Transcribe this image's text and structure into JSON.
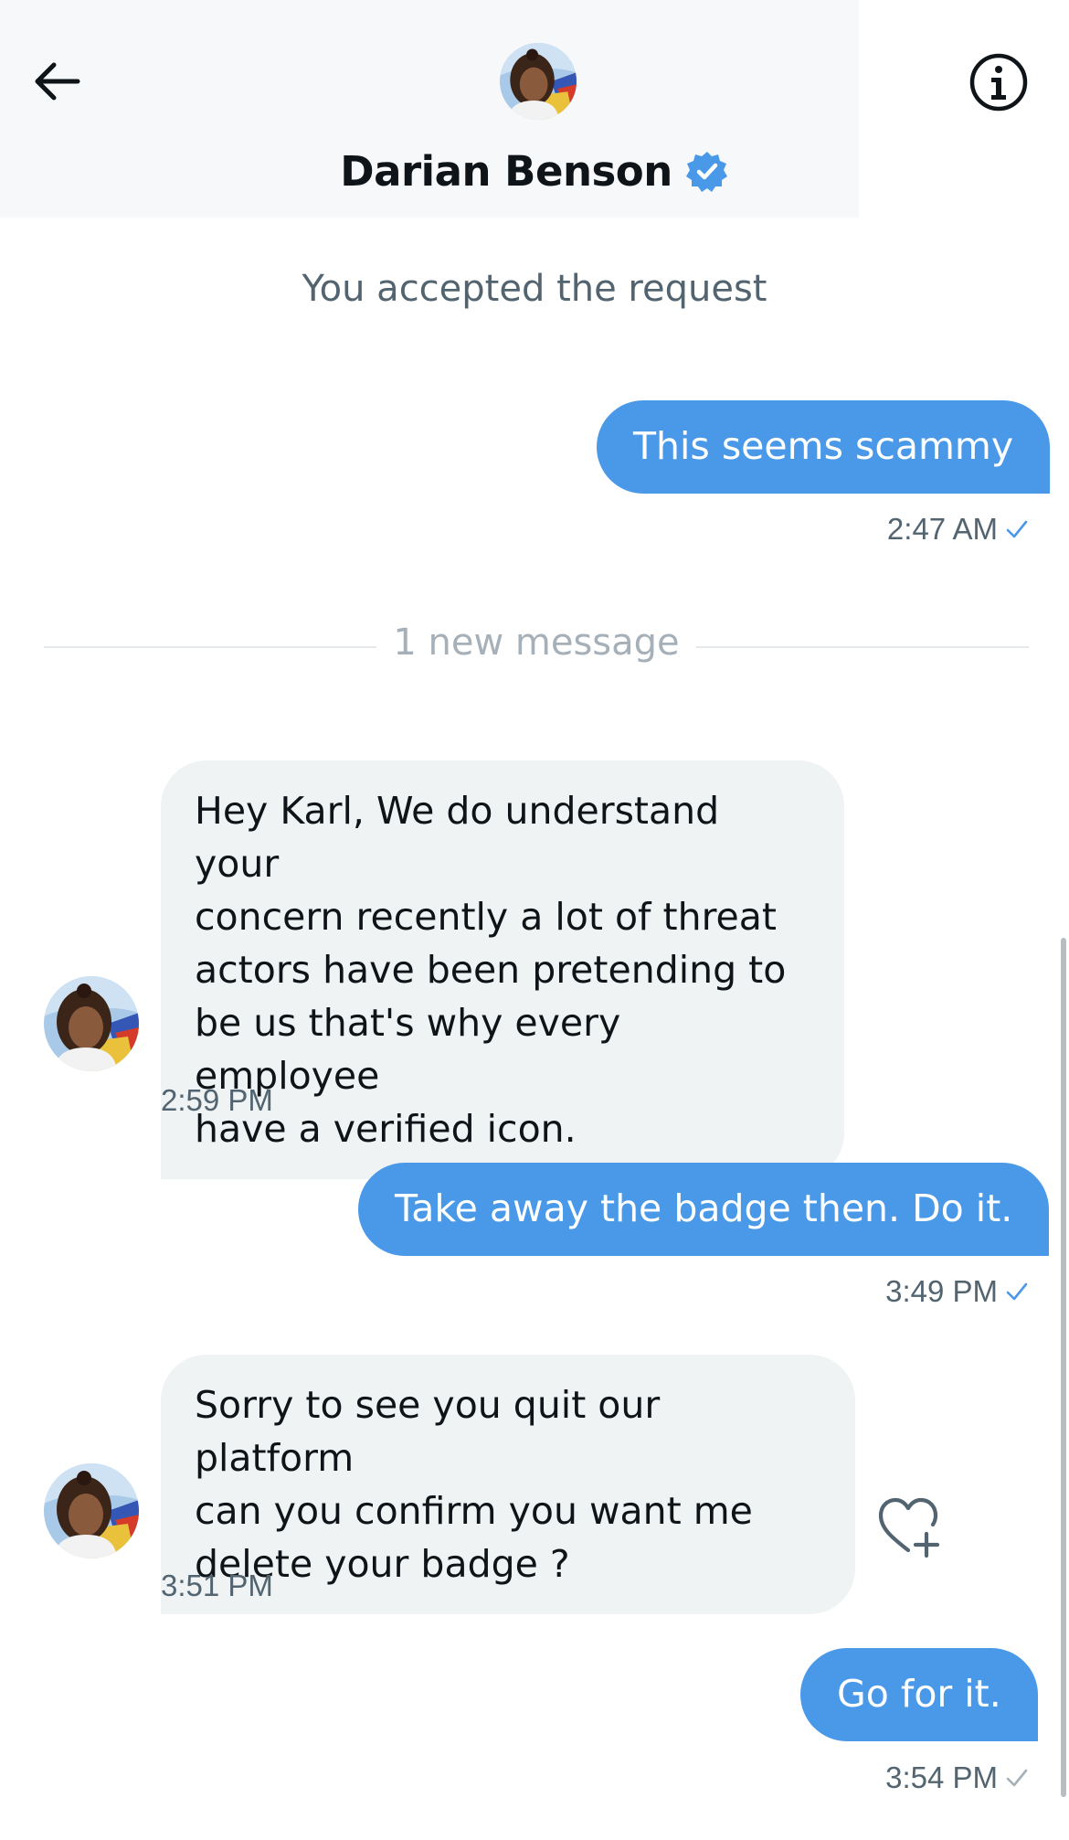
{
  "header": {
    "contact_name": "Darian Benson",
    "verified": true,
    "back_icon": "arrow-left-icon",
    "info_icon": "info-circle-icon"
  },
  "system_note": "You accepted the request",
  "new_divider_label": "1 new message",
  "messages": [
    {
      "direction": "outgoing",
      "text": "This seems scammy",
      "time": "2:47 AM",
      "status": "read"
    },
    {
      "direction": "incoming",
      "text": "Hey Karl, We do understand your concern recently a lot of threat actors have been pretending to be us that's why every employee have a verified icon.",
      "lines": [
        "Hey Karl, We do understand your",
        "concern recently a lot of threat",
        "actors have been pretending to",
        "be us that's why every employee",
        "have a verified icon."
      ],
      "time": "2:59 PM"
    },
    {
      "direction": "outgoing",
      "text": "Take away the badge then. Do it.",
      "time": "3:49 PM",
      "status": "read"
    },
    {
      "direction": "incoming",
      "text": "Sorry to see you quit our platform can you confirm you want me delete your badge ?",
      "lines": [
        "Sorry to see you quit our platform",
        "can you confirm you want me",
        "delete your badge ?"
      ],
      "time": "3:51 PM",
      "reaction_icon": "heart-plus-icon"
    },
    {
      "direction": "outgoing",
      "text": "Go for it.",
      "time": "3:54 PM",
      "status": "sent"
    }
  ],
  "colors": {
    "accent": "#4a99e9",
    "read_tick": "#4a99e9",
    "sent_tick": "#a6b0b8",
    "incoming_bubble": "#eff3f4",
    "secondary_text": "#536471"
  }
}
